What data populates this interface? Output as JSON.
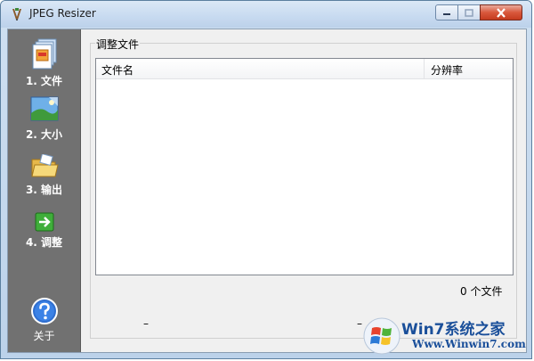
{
  "window": {
    "title": "JPEG Resizer"
  },
  "sidebar": {
    "items": [
      {
        "label": "1. 文件",
        "icon": "document-icon"
      },
      {
        "label": "2. 大小",
        "icon": "picture-icon"
      },
      {
        "label": "3. 输出",
        "icon": "folder-icon"
      },
      {
        "label": "4. 调整",
        "icon": "green-arrow-icon"
      }
    ],
    "about_label": "关于"
  },
  "panel": {
    "title": "调整文件",
    "columns": [
      "文件名",
      "分辨率"
    ],
    "rows": [],
    "file_count": "0 个文件",
    "status_left": "–",
    "status_right": "–"
  },
  "watermark": {
    "brand": "Win7系统之家",
    "url": "Www.Winwin7.com"
  },
  "colors": {
    "sidebar_bg": "#717171",
    "titlebar": "#c7daf0",
    "close_button": "#d9583c",
    "watermark_brand": "#1a4f9a"
  }
}
